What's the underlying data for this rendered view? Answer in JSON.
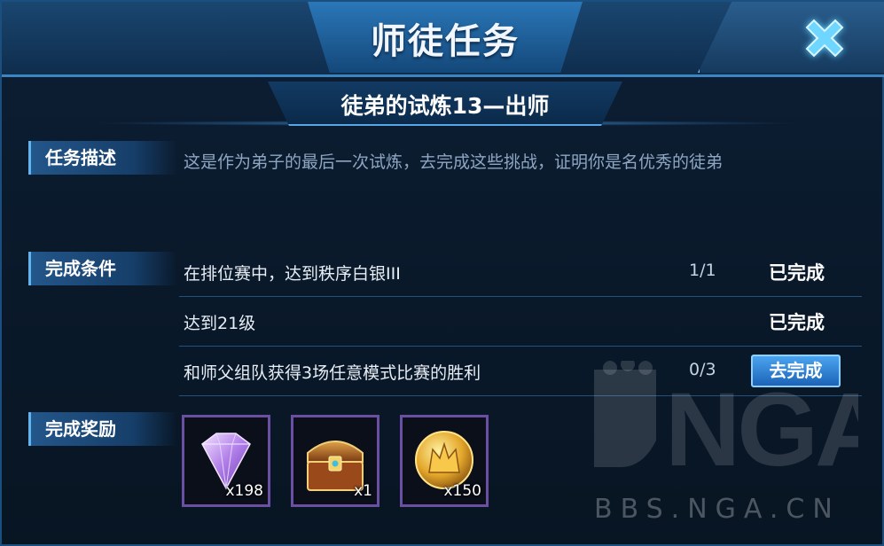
{
  "header": {
    "title": "师徒任务"
  },
  "task": {
    "subtitle": "徒弟的试炼13—出师"
  },
  "sections": {
    "description_label": "任务描述",
    "conditions_label": "完成条件",
    "rewards_label": "完成奖励"
  },
  "description": "这是作为弟子的最后一次试炼，去完成这些挑战，证明你是名优秀的徒弟",
  "conditions": [
    {
      "text": "在排位赛中，达到秩序白银III",
      "progress": "1/1",
      "status": "已完成"
    },
    {
      "text": "达到21级",
      "progress": "",
      "status": "已完成"
    },
    {
      "text": "和师父组队获得3场任意模式比赛的胜利",
      "progress": "0/3",
      "action": "去完成"
    }
  ],
  "rewards": [
    {
      "icon": "diamond-icon",
      "qty": "x198"
    },
    {
      "icon": "treasure-chest-icon",
      "qty": "x1"
    },
    {
      "icon": "gold-coin-icon",
      "qty": "x150"
    }
  ],
  "watermark": {
    "logo": "NGA",
    "url": "BBS.NGA.CN"
  },
  "colors": {
    "accent": "#3c85c3",
    "button": "#2a7fd4",
    "reward_border": "#6a4fa3"
  }
}
